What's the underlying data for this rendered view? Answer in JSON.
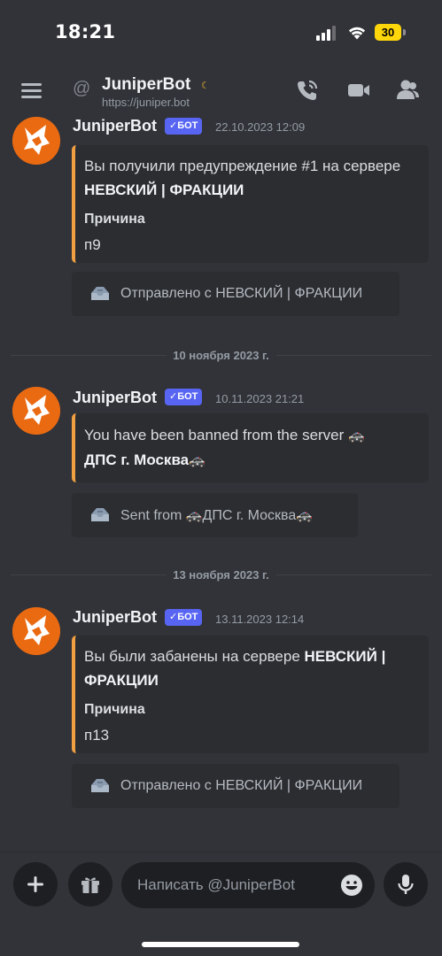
{
  "status_bar": {
    "time": "18:21",
    "battery": "30"
  },
  "header": {
    "title": "JuniperBot",
    "subtitle": "https://juniper.bot"
  },
  "bot_badge": "✓БОТ",
  "messages": [
    {
      "author": "JuniperBot",
      "timestamp": "22.10.2023 12:09",
      "desc_prefix": "Вы получили предупреждение #1 на сервере ",
      "desc_bold": "НЕВСКИЙ | ФРАКЦИИ",
      "field_name": "Причина",
      "field_value": "п9",
      "sent_from": "Отправлено с НЕВСКИЙ | ФРАКЦИИ"
    },
    {
      "author": "JuniperBot",
      "timestamp": "10.11.2023 21:21",
      "desc_prefix": "You have been banned from the server ",
      "desc_bold": "ДПС г. Москва",
      "sent_prefix": "Sent from ",
      "sent_name": "ДПС г. Москва"
    },
    {
      "author": "JuniperBot",
      "timestamp": "13.11.2023 12:14",
      "desc_prefix": "Вы были забанены на сервере ",
      "desc_bold": "НЕВСКИЙ | ФРАКЦИИ",
      "field_name": "Причина",
      "field_value": "п13",
      "sent_from": "Отправлено с НЕВСКИЙ | ФРАКЦИИ"
    }
  ],
  "dividers": [
    "10 ноября 2023 г.",
    "13 ноября 2023 г."
  ],
  "composer": {
    "placeholder": "Написать @JuniperBot"
  },
  "colors": {
    "background": "#313338",
    "embed_bg": "#2b2d31",
    "embed_accent": "#f0a043",
    "bot_badge": "#5865f2",
    "avatar": "#ea6a12"
  },
  "icons": [
    "hamburger-icon",
    "at-icon",
    "moon-icon",
    "phone-call-icon",
    "video-icon",
    "members-icon",
    "inbox-tray-icon",
    "police-car-icon",
    "plus-icon",
    "gift-icon",
    "emoji-icon",
    "microphone-icon"
  ]
}
